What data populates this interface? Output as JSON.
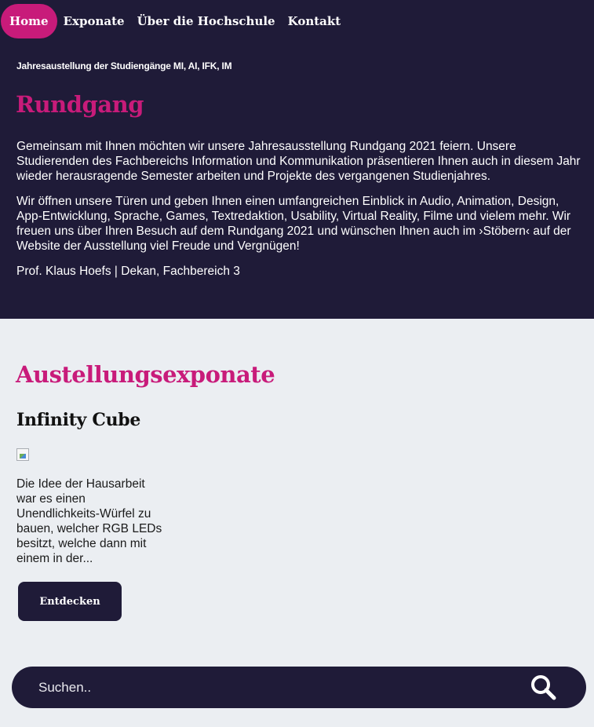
{
  "nav": {
    "items": [
      {
        "label": "Home",
        "active": true
      },
      {
        "label": "Exponate",
        "active": false
      },
      {
        "label": "Über die Hochschule",
        "active": false
      },
      {
        "label": "Kontakt",
        "active": false
      }
    ]
  },
  "hero": {
    "eyebrow": "Jahresaustellung der Studiengänge MI, AI, IFK, IM",
    "title": "Rundgang",
    "paragraphs": [
      "Gemeinsam mit Ihnen möchten wir unsere Jahresausstellung Rundgang 2021 feiern. Unsere Studierenden des Fachbereichs Information und Kommunikation präsentieren Ihnen auch in diesem Jahr wieder herausragende Semester arbeiten und Projekte des vergangenen Studienjahres.",
      "Wir öffnen unsere Türen und geben Ihnen einen umfangreichen Einblick in Audio, Animation, Design, App-Entwicklung, Sprache, Games, Textredaktion, Usability, Virtual Reality, Filme und vielem mehr. Wir freuen uns über Ihren Besuch auf dem Rundgang 2021 und wünschen Ihnen auch im ›Stöbern‹ auf der Website der Ausstellung viel Freude und Vergnügen!",
      "Prof. Klaus Hoefs | Dekan, Fachbereich 3"
    ]
  },
  "exhibits": {
    "title": "Austellungsexponate",
    "card": {
      "title": "Infinity Cube",
      "description": "Die Idee der Hausarbeit war es einen Unendlichkeits-Würfel zu bauen, welcher RGB LEDs besitzt, welche dann mit einem in der...",
      "button_label": "Entdecken"
    }
  },
  "search": {
    "placeholder": "Suchen..",
    "icon": "search-icon"
  },
  "colors": {
    "dark": "#1f1b38",
    "accent": "#c81b7a",
    "background": "#ebeef2"
  }
}
